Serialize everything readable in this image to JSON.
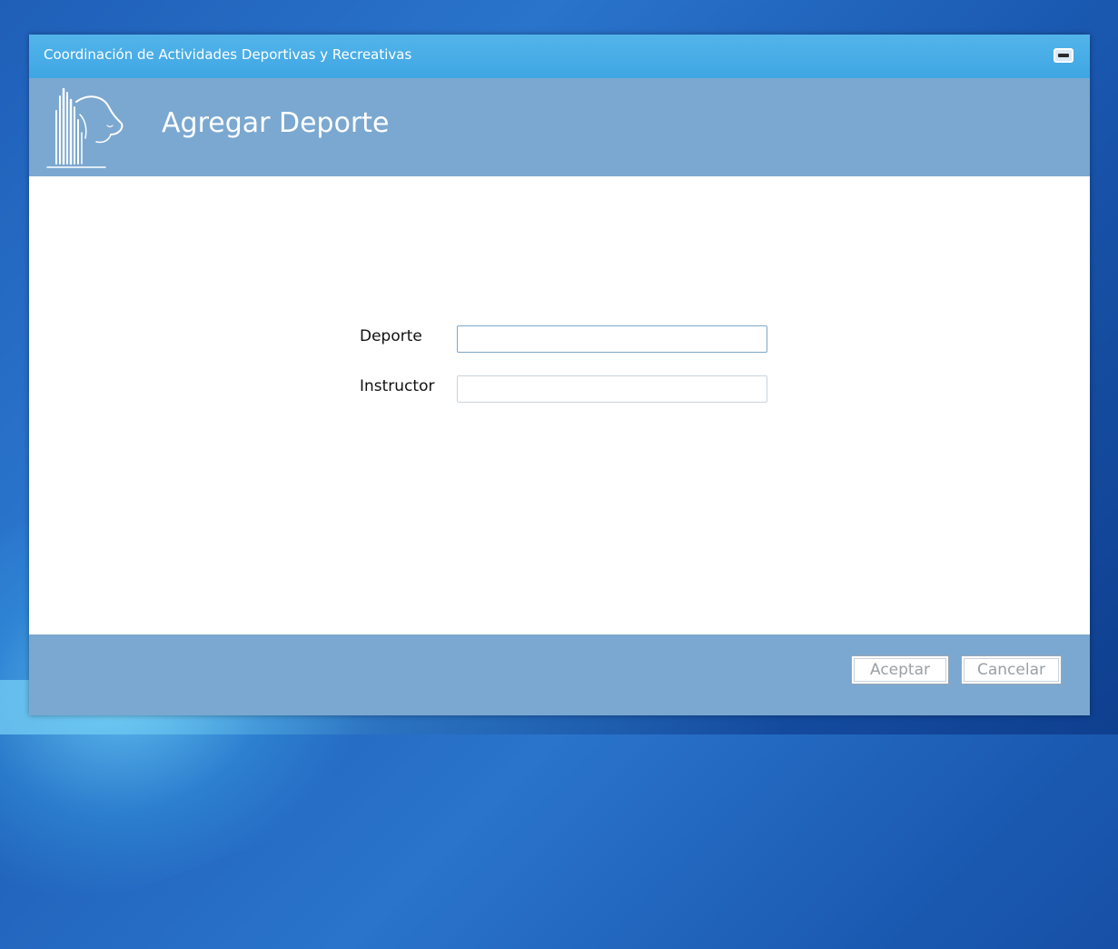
{
  "window": {
    "title": "Coordinación de Actividades Deportivas y Recreativas",
    "minimize_icon": "minimize-icon"
  },
  "header": {
    "title": "Agregar Deporte",
    "logo_icon": "university-library-lion-logo"
  },
  "form": {
    "sport": {
      "label": "Deporte",
      "value": "",
      "placeholder": ""
    },
    "instructor": {
      "label": "Instructor",
      "value": "",
      "placeholder": ""
    }
  },
  "footer": {
    "accept_label": "Aceptar",
    "cancel_label": "Cancelar"
  },
  "colors": {
    "titlebar": "#4aaee6",
    "header_band": "#7ba8d0",
    "button_text": "#9aa0a6"
  }
}
